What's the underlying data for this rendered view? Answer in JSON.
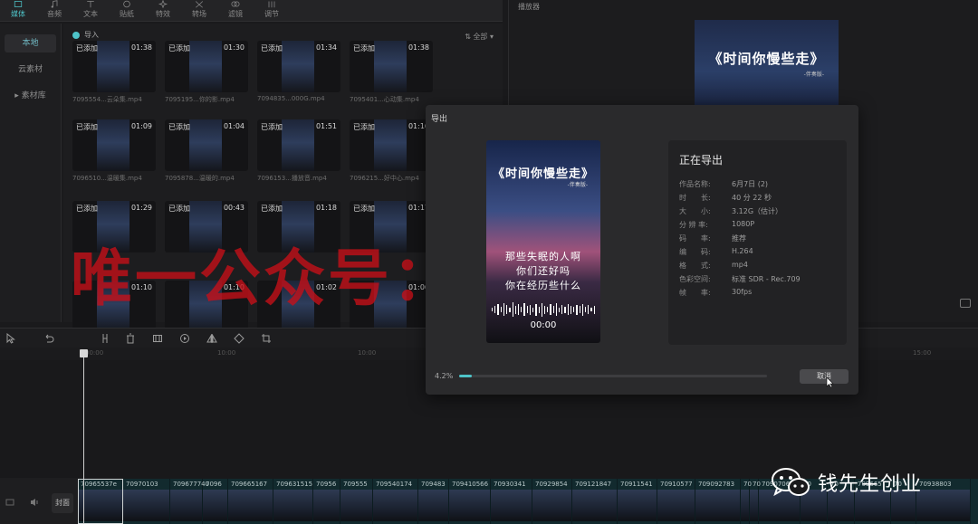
{
  "toolbar": {
    "tools": [
      {
        "label": "媒体",
        "icon": "media-icon",
        "active": true
      },
      {
        "label": "音频",
        "icon": "audio-icon"
      },
      {
        "label": "文本",
        "icon": "text-icon"
      },
      {
        "label": "贴纸",
        "icon": "sticker-icon"
      },
      {
        "label": "特效",
        "icon": "effects-icon"
      },
      {
        "label": "转场",
        "icon": "transition-icon"
      },
      {
        "label": "滤镜",
        "icon": "filter-icon"
      },
      {
        "label": "调节",
        "icon": "adjust-icon"
      }
    ]
  },
  "leftnav": {
    "items": [
      {
        "label": "本地",
        "active": true
      },
      {
        "label": "云素材"
      },
      {
        "label": "▸ 素材库"
      }
    ]
  },
  "media": {
    "import_label": "导入",
    "sort_label": "⇅ 全部 ▾",
    "clips": [
      {
        "tag": "已添加",
        "dur": "01:38",
        "name": "7095554...云朵集.mp4"
      },
      {
        "tag": "已添加",
        "dur": "01:30",
        "name": "7095195...你的影.mp4"
      },
      {
        "tag": "已添加",
        "dur": "01:34",
        "name": "7094835...000G.mp4"
      },
      {
        "tag": "已添加",
        "dur": "01:38",
        "name": "7095401...心动集.mp4"
      },
      {
        "tag": "已添加",
        "dur": "01:09",
        "name": "7096510...温暖集.mp4"
      },
      {
        "tag": "已添加",
        "dur": "01:04",
        "name": "7095878...温暖的.mp4"
      },
      {
        "tag": "已添加",
        "dur": "01:51",
        "name": "7096153...播放音.mp4"
      },
      {
        "tag": "已添加",
        "dur": "01:16",
        "name": "7096215...好中心.mp4"
      },
      {
        "tag": "已添加",
        "dur": "01:29",
        "name": ""
      },
      {
        "tag": "已添加",
        "dur": "00:43",
        "name": ""
      },
      {
        "tag": "已添加",
        "dur": "01:18",
        "name": ""
      },
      {
        "tag": "已添加",
        "dur": "01:17",
        "name": ""
      },
      {
        "tag": "",
        "dur": "01:10",
        "name": ""
      },
      {
        "tag": "",
        "dur": "01:10",
        "name": ""
      },
      {
        "tag": "",
        "dur": "01:02",
        "name": ""
      },
      {
        "tag": "",
        "dur": "01:06",
        "name": ""
      }
    ]
  },
  "player": {
    "title": "播放器",
    "preview_title": "《时间你慢些走》",
    "preview_sub": "-伴奏版-"
  },
  "timeline": {
    "ruler": [
      "00:00",
      "10:00",
      "10:00",
      "15:00"
    ],
    "cover_label": "封面",
    "clips": [
      "70965537e",
      "70970103",
      "709677740",
      "7096",
      "709665167",
      "709631515",
      "70956",
      "709555",
      "709540174",
      "709483",
      "709410566",
      "70930341",
      "70929854",
      "709121847",
      "70911541",
      "70910577",
      "709092783",
      "70",
      "70",
      "709070638",
      "70",
      "70",
      "709665",
      "70",
      "70938803"
    ]
  },
  "dialog": {
    "title": "导出",
    "poster": {
      "title": "《时间你慢些走》",
      "sub": "-伴奏版-",
      "lines": [
        "那些失眠的人啊",
        "你们还好吗",
        "你在经历些什么"
      ],
      "time": "00:00"
    },
    "info": {
      "heading": "正在导出",
      "rows": [
        {
          "k": "作品名称:",
          "v": "6月7日 (2)"
        },
        {
          "k": "时　　长:",
          "v": "40 分 22 秒"
        },
        {
          "k": "大　　小:",
          "v": "3.12G（估计）"
        },
        {
          "k": "分 辨 率:",
          "v": "1080P"
        },
        {
          "k": "码　　率:",
          "v": "推荐"
        },
        {
          "k": "编　　码:",
          "v": "H.264"
        },
        {
          "k": "格　　式:",
          "v": "mp4"
        },
        {
          "k": "色彩空间:",
          "v": "标准 SDR - Rec.709"
        },
        {
          "k": "帧　　率:",
          "v": "30fps"
        }
      ]
    },
    "progress_text": "4.2%",
    "progress_fraction": 0.042,
    "cancel_label": "取消"
  },
  "watermark": "唯一公众号：钱先生创业",
  "brand": {
    "name": "钱先生创业",
    "icon": "wechat-icon"
  },
  "colors": {
    "accent": "#4ec3c8",
    "watermark": "#c81018"
  }
}
